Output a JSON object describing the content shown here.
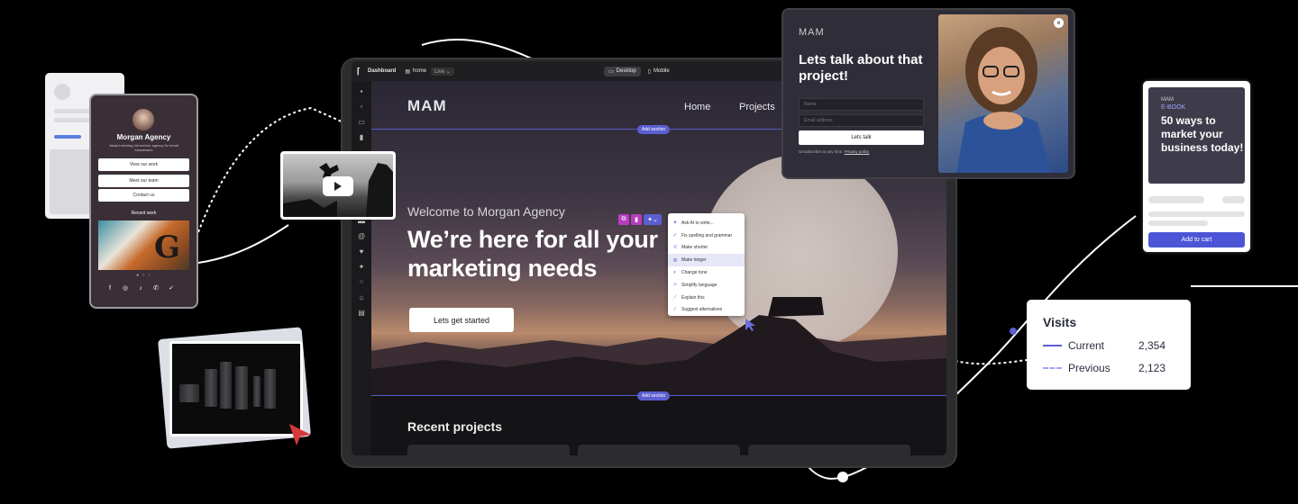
{
  "editor": {
    "topbar": {
      "dashboard": "Dashboard",
      "page": "home",
      "status": "Live",
      "desktop": "Desktop",
      "mobile": "Mobile"
    },
    "site": {
      "logo": "MAM",
      "nav": [
        "Home",
        "Projects"
      ],
      "add_section": "Add section",
      "welcome": "Welcome to Morgan Agency",
      "headline": "We’re here for all your marketing needs",
      "cta": "Lets get started",
      "recent_projects": "Recent projects"
    },
    "ai_menu": [
      {
        "icon": "sparkle-icon",
        "label": "Ask AI to write..."
      },
      {
        "icon": "check-icon",
        "label": "Fix spelling and grammar"
      },
      {
        "icon": "shorten-icon",
        "label": "Make shorter"
      },
      {
        "icon": "lengthen-icon",
        "label": "Make longer",
        "active": true
      },
      {
        "icon": "tone-icon",
        "label": "Change tone"
      },
      {
        "icon": "simplify-icon",
        "label": "Simplify language"
      },
      {
        "icon": "wand-icon",
        "label": "Explain this"
      },
      {
        "icon": "wand-icon",
        "label": "Suggest alternatives"
      }
    ]
  },
  "popup": {
    "logo": "MAM",
    "title": "Lets talk about that project!",
    "name_placeholder": "Name",
    "email_placeholder": "Email address",
    "button": "Lets talk",
    "legal_prefix": "Unsubscribe at any time.",
    "legal_link": "Privacy policy"
  },
  "ebook": {
    "logo": "MAM",
    "tag": "E-BOOK",
    "title": "50 ways to market your business today!",
    "button": "Add to cart"
  },
  "visits": {
    "title": "Visits",
    "rows": [
      {
        "label": "Current",
        "value": "2,354",
        "style": "solid"
      },
      {
        "label": "Previous",
        "value": "2,123",
        "style": "dashed"
      }
    ]
  },
  "bio": {
    "name": "Morgan Agency",
    "description": "Award winning full service agency for small businesses",
    "buttons": [
      "View our work",
      "Meet our team",
      "Contact us"
    ],
    "recent": "Recent work",
    "social": [
      "facebook-icon",
      "instagram-icon",
      "tiktok-icon",
      "whatsapp-icon",
      "twitter-icon"
    ]
  },
  "colors": {
    "accent": "#5b5fd1",
    "ebook_button": "#4b55d6",
    "cursor_red": "#d63a3a"
  }
}
